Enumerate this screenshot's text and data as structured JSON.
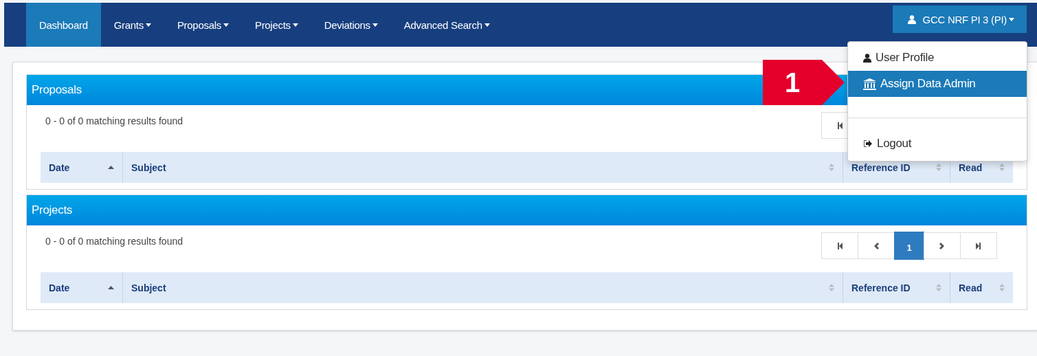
{
  "navbar": {
    "items": [
      {
        "label": "Dashboard",
        "selected": true,
        "dropdown": false
      },
      {
        "label": "Grants",
        "selected": false,
        "dropdown": true
      },
      {
        "label": "Proposals",
        "selected": false,
        "dropdown": true
      },
      {
        "label": "Projects",
        "selected": false,
        "dropdown": true
      },
      {
        "label": "Deviations",
        "selected": false,
        "dropdown": true
      },
      {
        "label": "Advanced Search",
        "selected": false,
        "dropdown": true
      }
    ],
    "user": {
      "label": "GCC NRF PI 3 (PI)"
    }
  },
  "user_menu": {
    "items": [
      {
        "kind": "profile",
        "label": "User Profile",
        "selected": false
      },
      {
        "kind": "admin",
        "label": "Assign Data Admin",
        "selected": true
      },
      {
        "kind": "blank"
      },
      {
        "kind": "logout",
        "label": "Logout",
        "selected": false
      }
    ]
  },
  "callout": {
    "label": "1"
  },
  "panels": [
    {
      "title": "Proposals",
      "results": "0 - 0 of 0 matching results found",
      "pagination": [
        {
          "kind": "first",
          "selected": false
        }
      ],
      "columns": [
        {
          "label": "Date",
          "sorted": true
        },
        {
          "label": "Subject",
          "sorted": false
        },
        {
          "label": "Reference ID",
          "sorted": false
        },
        {
          "label": "Read",
          "sorted": false
        }
      ]
    },
    {
      "title": "Projects",
      "results": "0 - 0 of 0 matching results found",
      "pagination": [
        {
          "kind": "first",
          "selected": false
        },
        {
          "kind": "prev",
          "selected": false
        },
        {
          "kind": "page",
          "label": "1",
          "selected": true
        },
        {
          "kind": "next",
          "selected": false
        },
        {
          "kind": "last",
          "selected": false
        }
      ],
      "columns": [
        {
          "label": "Date",
          "sorted": true
        },
        {
          "label": "Subject",
          "sorted": false
        },
        {
          "label": "Reference ID",
          "sorted": false
        },
        {
          "label": "Read",
          "sorted": false
        }
      ]
    }
  ]
}
